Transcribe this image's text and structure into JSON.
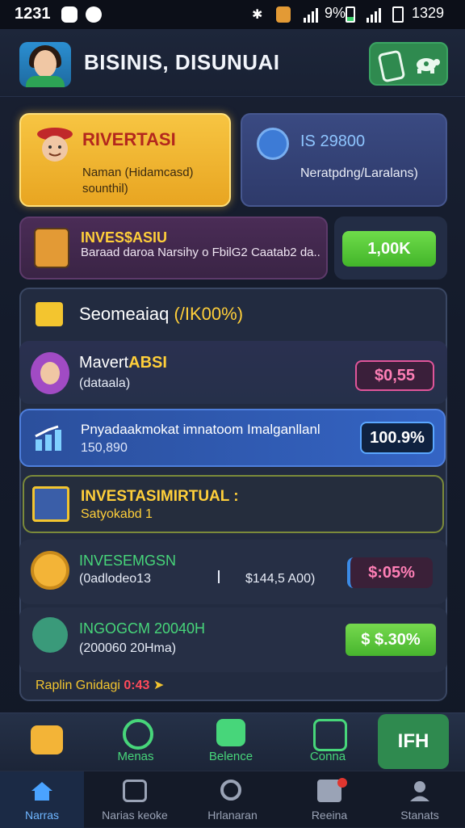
{
  "status_bar": {
    "time_left": "1231",
    "battery": "9%",
    "time_right": "1329"
  },
  "header": {
    "title": "BISINIS, DISUNUAI"
  },
  "card_gold": {
    "title": "RIVERTASI",
    "subtitle": "Naman (Hidamcasd) sounthil)"
  },
  "card_blue": {
    "value": "IS 29800",
    "subtitle": "Neratpdng/Laralans)"
  },
  "invest_row": {
    "title": "INVES$ASIU",
    "description": "Baraad daroa Narsihy o FbilG2 Caatab2 da..",
    "button": "1,00K"
  },
  "panel": {
    "title_main": "Seomeaiaq",
    "title_pct": "(/IK00%)"
  },
  "items": {
    "maverta": {
      "title_a": "Mavert",
      "title_b": "ABSI",
      "subtitle": "(dataala)",
      "badge": "$0,55"
    },
    "promo": {
      "title": "Pnyadaakmokat imnatoom Imalganllanl",
      "subtitle": "150,890",
      "badge": "100.9%"
    },
    "virtual": {
      "title": "INVESTASIMIRTUAL :",
      "subtitle": "Satyokabd 1"
    },
    "invesmgsn": {
      "title": "INVESEMGSN",
      "subtitle": "(0adlodeo13",
      "amount": "$144,5 A00)",
      "badge": "$:05%"
    },
    "ingogm": {
      "title": "INGOGCM 20040H",
      "subtitle": "(200060 20Hma)",
      "badge": "$ $.30%"
    }
  },
  "footer_line": {
    "text": "Raplin Gnidagi",
    "timer": "0:43"
  },
  "action_bar": {
    "menas": "Menas",
    "belence": "Belence",
    "conna": "Conna",
    "right_label": "IFH"
  },
  "bottom_nav": [
    {
      "label": "Narras"
    },
    {
      "label": "Narias keoke"
    },
    {
      "label": "Hrlanaran"
    },
    {
      "label": "Reeina"
    },
    {
      "label": "Stanats"
    }
  ],
  "colors": {
    "accent_gold": "#f7c542",
    "accent_green": "#47d67a",
    "accent_pink": "#ff7fb6",
    "accent_blue": "#3464c4"
  }
}
